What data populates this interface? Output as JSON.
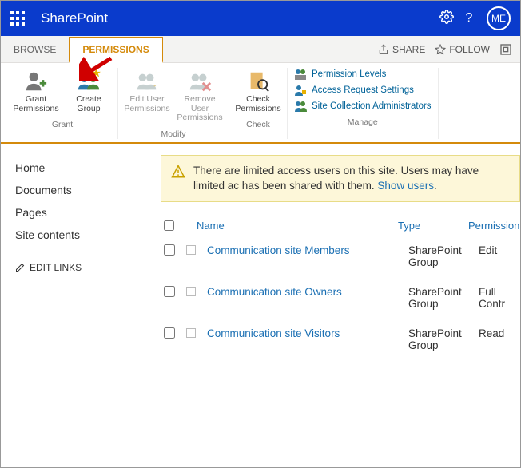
{
  "suite": {
    "brand": "SharePoint",
    "avatar": "ME"
  },
  "tabs": {
    "browse": "BROWSE",
    "permissions": "PERMISSIONS"
  },
  "strip": {
    "share": "SHARE",
    "follow": "FOLLOW"
  },
  "ribbon": {
    "grantGroup": "Grant",
    "modifyGroup": "Modify",
    "checkGroup": "Check",
    "manageGroup": "Manage",
    "grantPerm": "Grant Permissions",
    "createGroup": "Create Group",
    "editUser": "Edit User Permissions",
    "removeUser": "Remove User Permissions",
    "checkPerm": "Check Permissions",
    "permLevels": "Permission Levels",
    "accessReq": "Access Request Settings",
    "siteColl": "Site Collection Administrators"
  },
  "nav": {
    "home": "Home",
    "documents": "Documents",
    "pages": "Pages",
    "siteContents": "Site contents",
    "editLinks": "EDIT LINKS"
  },
  "warn": {
    "text1": "There are limited access users on this site. Users may have limited ac",
    "text2": "has been shared with them.",
    "show": "Show users",
    "dot": "."
  },
  "cols": {
    "name": "Name",
    "type": "Type",
    "perm": "Permission"
  },
  "rows": [
    {
      "name": "Communication site Members",
      "type": "SharePoint Group",
      "perm": "Edit"
    },
    {
      "name": "Communication site Owners",
      "type": "SharePoint Group",
      "perm": "Full Contr"
    },
    {
      "name": "Communication site Visitors",
      "type": "SharePoint Group",
      "perm": "Read"
    }
  ]
}
